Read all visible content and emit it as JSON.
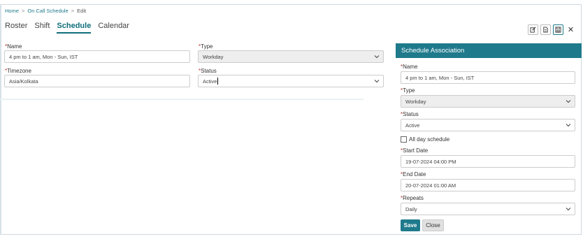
{
  "breadcrumb": {
    "home": "Home",
    "parent": "On Call Schedule",
    "current": "Edit",
    "separator": ">"
  },
  "tabs": [
    {
      "label": "Roster",
      "active": false
    },
    {
      "label": "Shift",
      "active": false
    },
    {
      "label": "Schedule",
      "active": true
    },
    {
      "label": "Calendar",
      "active": false
    }
  ],
  "toolbar": {
    "icons": [
      "edit-icon",
      "document-icon",
      "save-icon",
      "close-icon"
    ],
    "close_glyph": "✕"
  },
  "form": {
    "name_label": "Name",
    "name_value": "4 pm to 1 am, Mon - Sun, IST",
    "type_label": "Type",
    "type_value": "Workday",
    "timezone_label": "Timezone",
    "timezone_value": "Asia/Kolkata",
    "status_label": "Status",
    "status_value": "Active",
    "required_mark": "*"
  },
  "panel": {
    "title": "Schedule Association",
    "name_label": "Name",
    "name_value": "4 pm to 1 am, Mon - Sun, IST",
    "type_label": "Type",
    "type_value": "Workday",
    "status_label": "Status",
    "status_value": "Active",
    "all_day_label": "All day schedule",
    "all_day_checked": false,
    "start_label": "Start Date",
    "start_value": "19-07-2024 04:00 PM",
    "end_label": "End Date",
    "end_value": "20-07-2024 01:00 AM",
    "repeats_label": "Repeats",
    "repeats_value": "Daily",
    "save_label": "Save",
    "close_label": "Close"
  },
  "colors": {
    "accent": "#1f7a8c",
    "required": "#c0392b",
    "disabled_bg": "#eeeeee"
  }
}
